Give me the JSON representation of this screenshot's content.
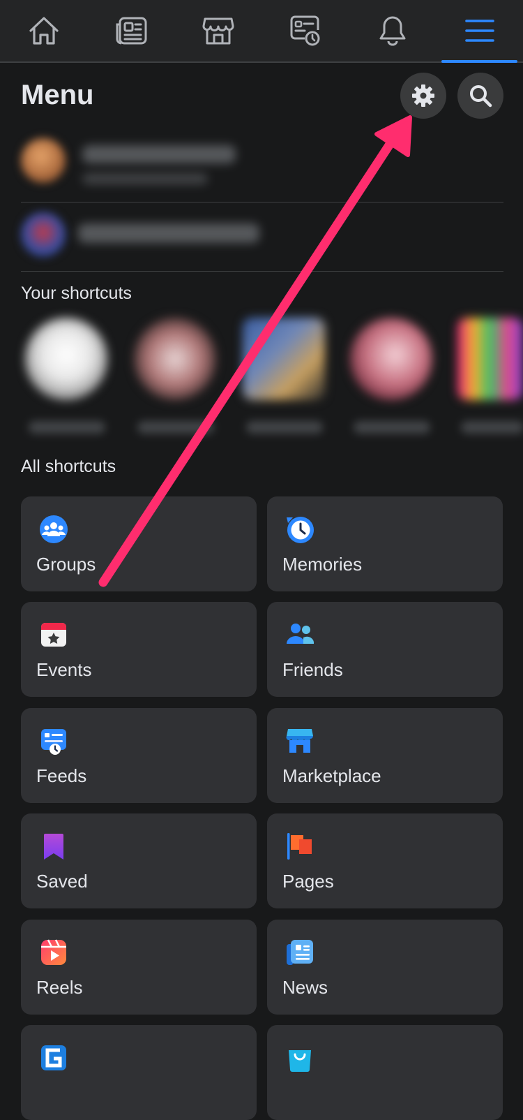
{
  "nav": {
    "items": [
      {
        "name": "home-icon"
      },
      {
        "name": "news-feed-icon"
      },
      {
        "name": "marketplace-icon"
      },
      {
        "name": "feeds-icon"
      },
      {
        "name": "notifications-bell-icon"
      },
      {
        "name": "menu-hamburger-icon",
        "active": true
      }
    ]
  },
  "header": {
    "title": "Menu"
  },
  "sections": {
    "your_shortcuts": "Your shortcuts",
    "all_shortcuts": "All shortcuts"
  },
  "tiles": [
    {
      "label": "Groups",
      "icon": "groups-icon"
    },
    {
      "label": "Memories",
      "icon": "memories-icon"
    },
    {
      "label": "Events",
      "icon": "events-icon"
    },
    {
      "label": "Friends",
      "icon": "friends-icon"
    },
    {
      "label": "Feeds",
      "icon": "feeds-icon"
    },
    {
      "label": "Marketplace",
      "icon": "marketplace-icon"
    },
    {
      "label": "Saved",
      "icon": "saved-icon"
    },
    {
      "label": "Pages",
      "icon": "pages-icon"
    },
    {
      "label": "Reels",
      "icon": "reels-icon"
    },
    {
      "label": "News",
      "icon": "news-icon"
    }
  ],
  "colors": {
    "accent": "#2d88ff",
    "arrow": "#ff2d6e",
    "tile": "#303134",
    "background": "#18191a"
  }
}
